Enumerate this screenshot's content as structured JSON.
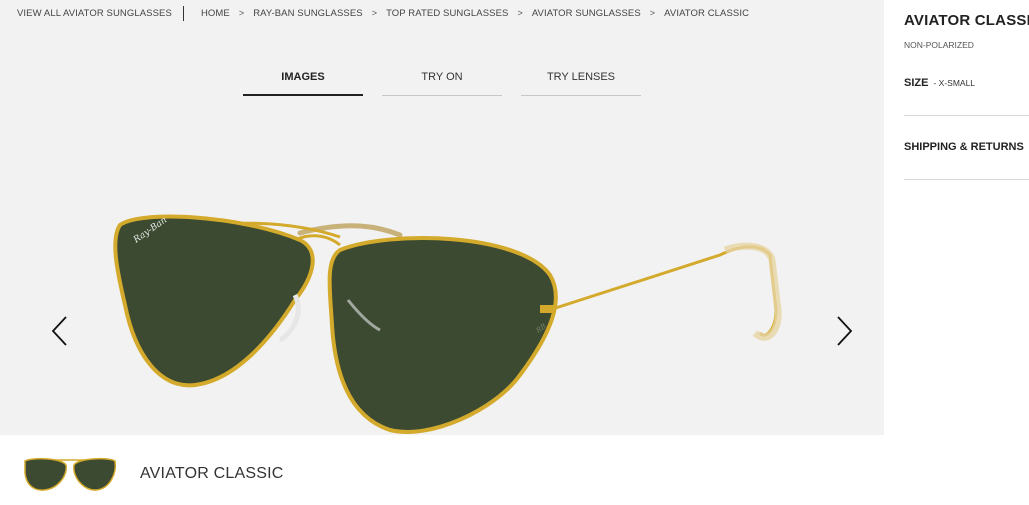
{
  "breadcrumb": {
    "view_all": "VIEW ALL AVIATOR SUNGLASSES",
    "items": [
      "HOME",
      "RAY-BAN SUNGLASSES",
      "TOP RATED SUNGLASSES",
      "AVIATOR SUNGLASSES",
      "AVIATOR CLASSIC"
    ]
  },
  "tabs": [
    {
      "label": "IMAGES",
      "active": true
    },
    {
      "label": "TRY ON"
    },
    {
      "label": "TRY LENSES"
    }
  ],
  "icons": {
    "prev": "chevron-left-icon",
    "next": "chevron-right-icon"
  },
  "product_image": {
    "brand_logo": "Ray-Ban",
    "frame_color": "#d4aa2c",
    "lens_color": "#3b4a30"
  },
  "thumbnail": {
    "title": "AVIATOR CLASSIC"
  },
  "panel": {
    "title": "AVIATOR CLASSIC",
    "subtitle": "NON-POLARIZED",
    "size_label": "SIZE",
    "size_value": "- X-SMALL",
    "shipping_label": "SHIPPING & RETURNS"
  }
}
